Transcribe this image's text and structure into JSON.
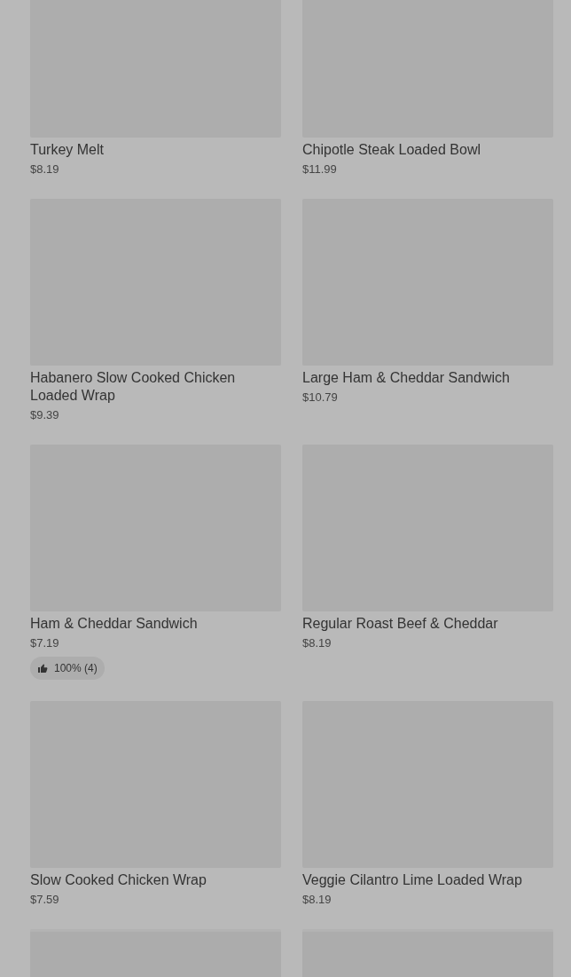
{
  "items": [
    {
      "name": "Turkey Melt",
      "price": "$8.19"
    },
    {
      "name": "Chipotle Steak Loaded Bowl",
      "price": "$11.99"
    },
    {
      "name": "Habanero Slow Cooked Chicken Loaded Wrap",
      "price": "$9.39"
    },
    {
      "name": "Large Ham & Cheddar Sandwich",
      "price": "$10.79"
    },
    {
      "name": "Ham & Cheddar Sandwich",
      "price": "$7.19",
      "rating": "100% (4)"
    },
    {
      "name": "Regular Roast Beef & Cheddar",
      "price": "$8.19"
    },
    {
      "name": "Slow Cooked Chicken Wrap",
      "price": "$7.59"
    },
    {
      "name": "Veggie Cilantro Lime Loaded Wrap",
      "price": "$8.19"
    },
    {
      "kind": "loading"
    },
    {
      "kind": "loading"
    }
  ]
}
